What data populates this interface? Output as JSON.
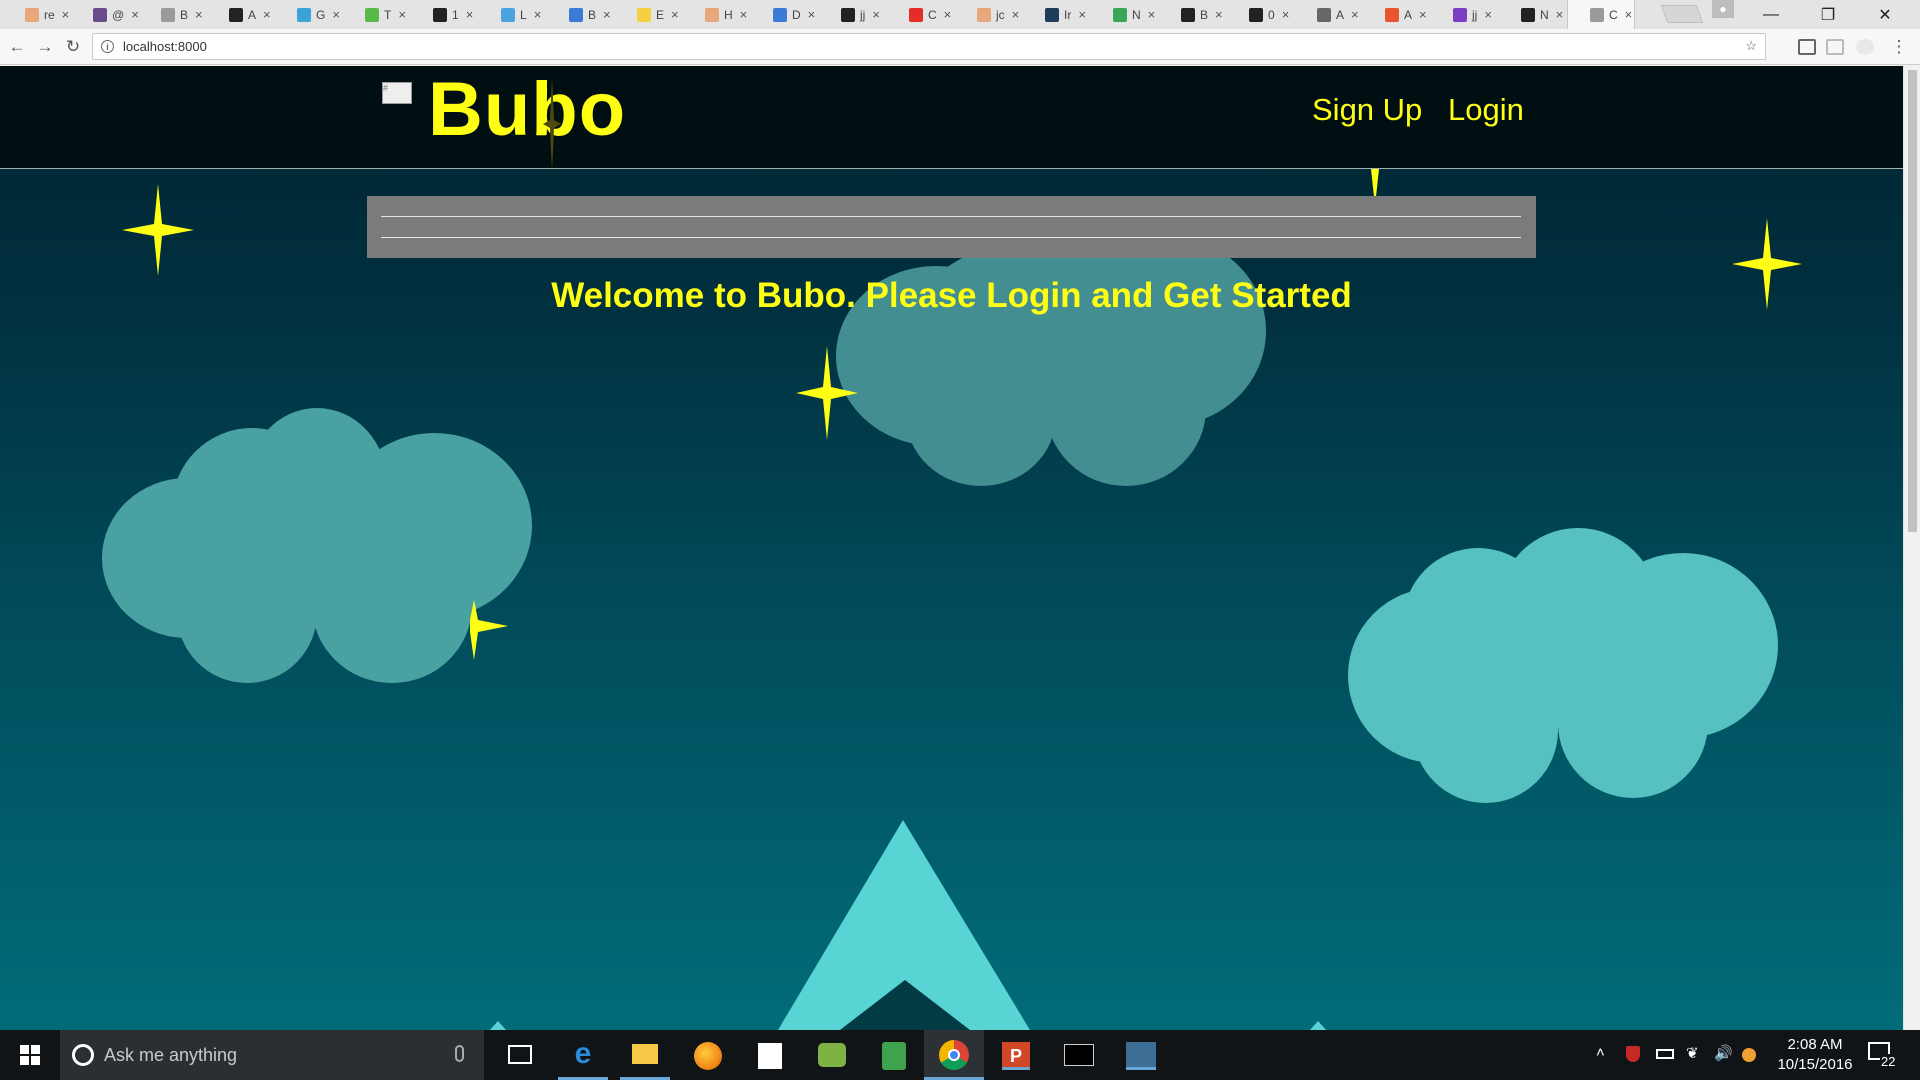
{
  "browser": {
    "tabs": [
      {
        "title": "re",
        "color": "#e8a87c"
      },
      {
        "title": "@",
        "color": "#6a4c8c"
      },
      {
        "title": "B",
        "color": "#9a9a9a"
      },
      {
        "title": "A",
        "color": "#222222"
      },
      {
        "title": "G",
        "color": "#3aa3d9"
      },
      {
        "title": "T",
        "color": "#58b947"
      },
      {
        "title": "1",
        "color": "#222222"
      },
      {
        "title": "L",
        "color": "#4aa3df"
      },
      {
        "title": "B",
        "color": "#3a7bd5"
      },
      {
        "title": "E",
        "color": "#f4d03f"
      },
      {
        "title": "H",
        "color": "#e8a87c"
      },
      {
        "title": "D",
        "color": "#3a7bd5"
      },
      {
        "title": "jj",
        "color": "#222222"
      },
      {
        "title": "C",
        "color": "#e52d27"
      },
      {
        "title": "jc",
        "color": "#e8a87c"
      },
      {
        "title": "Ir",
        "color": "#1f3b5a"
      },
      {
        "title": "N",
        "color": "#3aa757"
      },
      {
        "title": "B",
        "color": "#222222"
      },
      {
        "title": "0",
        "color": "#222222"
      },
      {
        "title": "A",
        "color": "#666666"
      },
      {
        "title": "A",
        "color": "#e8552d"
      },
      {
        "title": "jj",
        "color": "#7d3ec1"
      },
      {
        "title": "N",
        "color": "#222222"
      },
      {
        "title": "C",
        "color": "#9a9a9a"
      }
    ],
    "url": "localhost:8000",
    "profile_icon": "person-icon"
  },
  "site": {
    "brand": "Bubo",
    "logo_alt": "#",
    "nav": [
      {
        "label": "Sign Up"
      },
      {
        "label": "Login"
      }
    ],
    "welcome": "Welcome to Bubo. Please Login and Get Started"
  },
  "taskbar": {
    "search_placeholder": "Ask me anything",
    "time": "2:08 AM",
    "date": "10/15/2016",
    "notification_count": "22",
    "apps": [
      "task-view-icon",
      "edge-icon",
      "file-explorer-icon",
      "firefox-icon",
      "store-icon",
      "app-icon",
      "notes-icon",
      "chrome-icon",
      "powerpoint-icon",
      "terminal-icon",
      "mysql-workbench-icon"
    ]
  },
  "colors": {
    "accent": "#ffff14",
    "cloud_light": "#56c1c0",
    "cloud_mid": "#4aa1a2"
  }
}
